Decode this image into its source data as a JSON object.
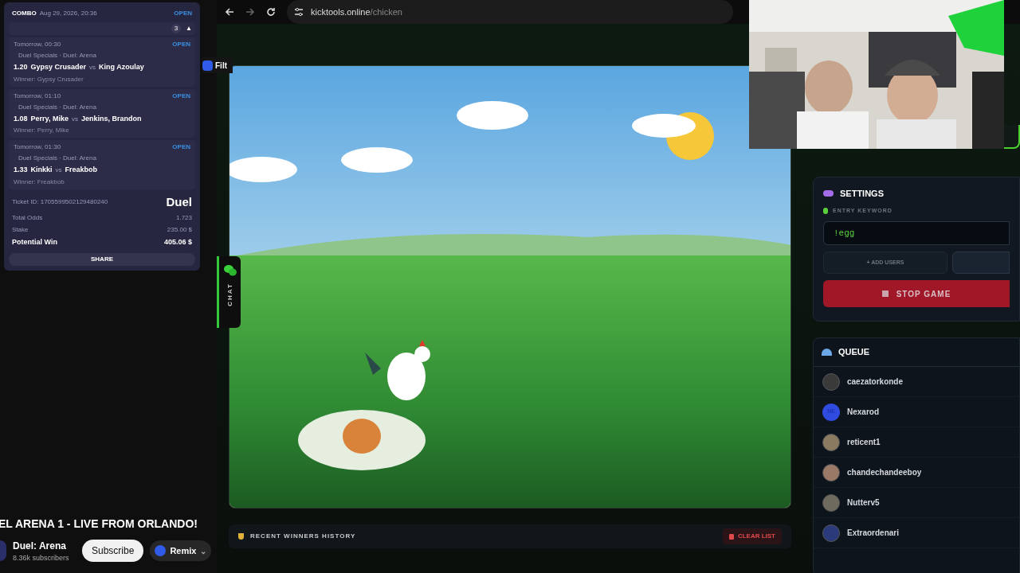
{
  "bet_slip": {
    "type": "COMBO",
    "date": "Aug 29, 2026, 20:36",
    "status": "OPEN",
    "count": "3",
    "caret": "▲",
    "legs": [
      {
        "time": "Tomorrow, 00:30",
        "status": "OPEN",
        "league": "Duel Specials · Duel: Arena",
        "odds": "1.20",
        "home": "Gypsy Crusader",
        "vs": "vs",
        "away": "King Azoulay",
        "pick": "Winner: Gypsy Crusader"
      },
      {
        "time": "Tomorrow, 01:10",
        "status": "OPEN",
        "league": "Duel Specials · Duel: Arena",
        "odds": "1.08",
        "home": "Perry, Mike",
        "vs": "vs",
        "away": "Jenkins, Brandon",
        "pick": "Winner: Perry, Mike"
      },
      {
        "time": "Tomorrow, 01:30",
        "status": "OPEN",
        "league": "Duel Specials · Duel: Arena",
        "odds": "1.33",
        "home": "Kinkki",
        "vs": "vs",
        "away": "Freakbob",
        "pick": "Winner: Freakbob"
      }
    ],
    "ticket_id": "Ticket ID: 1705599502129480240",
    "brand": "Duel",
    "totals": [
      {
        "label": "Total Odds",
        "value": "1.723",
        "bold": false
      },
      {
        "label": "Stake",
        "value": "235.00 $",
        "bold": false
      },
      {
        "label": "Potential Win",
        "value": "405.06 $",
        "bold": true
      }
    ],
    "share": "SHARE"
  },
  "side_tab": {
    "label": "Filt"
  },
  "video_info": {
    "title": "EL ARENA 1 - LIVE FROM ORLANDO!",
    "channel": "Duel: Arena",
    "subscribers": "8.36k subscribers",
    "subscribe": "Subscribe",
    "remix": "Remix",
    "chevron": "⌄"
  },
  "browser": {
    "url_host": "kicktools.online",
    "url_path": "/chicken"
  },
  "chat_tab": {
    "label": "CHAT"
  },
  "settings": {
    "title": "SETTINGS",
    "keyword_label": "ENTRY KEYWORD",
    "keyword": "!egg",
    "add_users": "+ ADD USERS",
    "stop": "STOP GAME"
  },
  "queue": {
    "title": "QUEUE",
    "users": [
      {
        "name": "caezatorkonde",
        "color": "#3a3a3a"
      },
      {
        "name": "Nexarod",
        "kind": "initials",
        "initials": "NE",
        "color": "#2f4be0"
      },
      {
        "name": "reticent1",
        "color": "#8a7a60"
      },
      {
        "name": "chandechandeeboy",
        "color": "#9a7a66"
      },
      {
        "name": "Nutterv5",
        "color": "#6f6a5e"
      },
      {
        "name": "Extraordenari",
        "color": "#2a3a7a"
      }
    ]
  },
  "winners": {
    "title": "RECENT WINNERS HISTORY",
    "clear": "CLEAR LIST"
  }
}
